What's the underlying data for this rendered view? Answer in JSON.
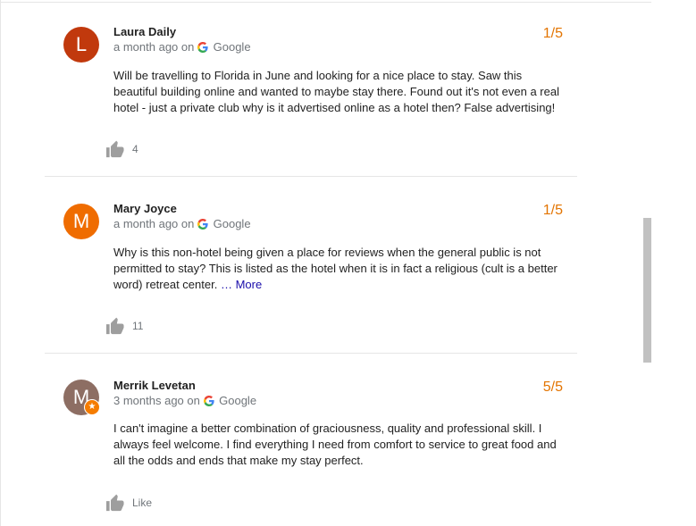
{
  "reviews": [
    {
      "initial": "L",
      "name": "Laura Daily",
      "time": "a month ago",
      "on": "on",
      "source": "Google",
      "rating": "1/5",
      "avatar_color": "#c1390d",
      "text": "Will be travelling to Florida in June and looking for a nice place to stay. Saw this beautiful building online and wanted to maybe stay there. Found out it's not even a real hotel - just a private club why is it advertised online as a hotel then? False advertising!",
      "more": "",
      "likes": "4"
    },
    {
      "initial": "M",
      "name": "Mary Joyce",
      "time": "a month ago",
      "on": "on",
      "source": "Google",
      "rating": "1/5",
      "avatar_color": "#ef6c00",
      "text": "Why is this non-hotel being given a place for reviews when the general public is not permitted to stay?  This is listed as the hotel when it is in fact a religious (cult is a better word) retreat center.",
      "more": "… More",
      "likes": "11"
    },
    {
      "initial": "M",
      "name": "Merrik Levetan",
      "time": "3 months ago",
      "on": "on",
      "source": "Google",
      "rating": "5/5",
      "avatar_color": "#8d6e63",
      "text": "I can't imagine a better combination of graciousness, quality and professional skill. I always feel welcome. I find everything I need from comfort to service to great food and all the odds and ends that make my stay perfect.",
      "more": "",
      "likes": "Like"
    }
  ],
  "icons": {
    "like": "thumbs-up-icon",
    "source": "google-g-icon",
    "local_guide": "local-guide-star-icon"
  },
  "colors": {
    "rating": "#e37400",
    "link": "#1a0dab",
    "meta": "#70757a"
  }
}
